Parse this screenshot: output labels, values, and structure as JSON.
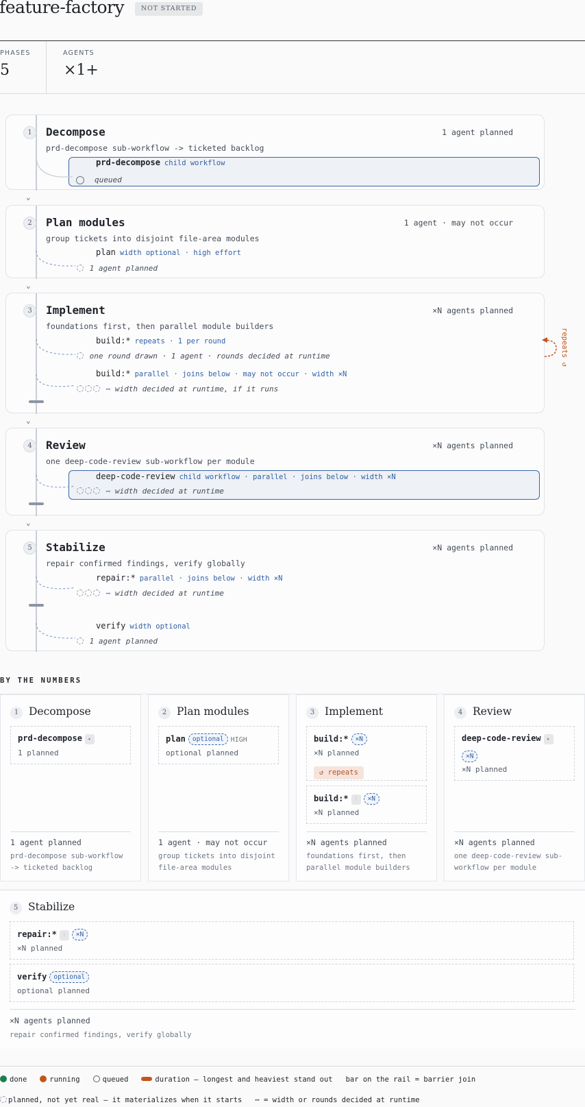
{
  "header": {
    "title": "feature-factory",
    "status": "NOT STARTED"
  },
  "stats": {
    "phases_label": "PHASES",
    "phases_value": "5",
    "agents_label": "AGENTS",
    "agents_value": "×1+"
  },
  "phases": [
    {
      "num": "1",
      "name": "Decompose",
      "meta": "1 agent planned",
      "desc": "prd-decompose sub-workflow -> ticketed backlog",
      "agents": [
        {
          "name": "prd-decompose",
          "tags": "child workflow",
          "note": "queued"
        }
      ]
    },
    {
      "num": "2",
      "name": "Plan modules",
      "meta": "1 agent · may not occur",
      "desc": "group tickets into disjoint file-area modules",
      "agents": [
        {
          "name": "plan",
          "tags": "width optional · high effort",
          "note": "1 agent planned"
        }
      ]
    },
    {
      "num": "3",
      "name": "Implement",
      "meta": "×N agents planned",
      "desc": "foundations first, then parallel module builders",
      "agents": [
        {
          "name": "build:*",
          "tags": "repeats · 1 per round",
          "note": "one round drawn · 1 agent · rounds decided at runtime"
        },
        {
          "name": "build:*",
          "tags": "parallel · joins below · may not occur · width ×N",
          "note": "width decided at runtime, if it runs"
        }
      ],
      "repeats_label": "repeats ↺"
    },
    {
      "num": "4",
      "name": "Review",
      "meta": "×N agents planned",
      "desc": "one deep-code-review sub-workflow per module",
      "agents": [
        {
          "name": "deep-code-review",
          "tags": "child workflow · parallel · joins below · width ×N",
          "note": "width decided at runtime"
        }
      ]
    },
    {
      "num": "5",
      "name": "Stabilize",
      "meta": "×N agents planned",
      "desc": "repair confirmed findings, verify globally",
      "agents": [
        {
          "name": "repair:*",
          "tags": "parallel · joins below · width ×N",
          "note": "width decided at runtime"
        },
        {
          "name": "verify",
          "tags": "width optional",
          "note": "1 agent planned"
        }
      ]
    }
  ],
  "numbers": {
    "heading": "BY THE NUMBERS",
    "cards": [
      {
        "num": "1",
        "name": "Decompose",
        "agents": [
          {
            "name": "prd-decompose",
            "sub": "1 planned"
          }
        ],
        "foot1": "1 agent planned",
        "foot2a": "prd-decompose sub-workflow",
        "foot2b": "-> ticketed backlog"
      },
      {
        "num": "2",
        "name": "Plan modules",
        "agents": [
          {
            "name": "plan",
            "pill": "optional",
            "high": "HIGH",
            "sub": "optional planned"
          }
        ],
        "foot1": "1 agent · may not occur",
        "foot2a": "group tickets into disjoint",
        "foot2b": "file-area modules"
      },
      {
        "num": "3",
        "name": "Implement",
        "agents": [
          {
            "name": "build:*",
            "pill": "×N",
            "sub": "×N planned",
            "badge": "↺ repeats"
          },
          {
            "name": "build:*",
            "pill": "×N",
            "sub": "×N planned"
          }
        ],
        "foot1": "×N agents planned",
        "foot2a": "foundations first, then",
        "foot2b": "parallel module builders"
      },
      {
        "num": "4",
        "name": "Review",
        "agents": [
          {
            "name": "deep-code-review",
            "pill": "×N",
            "sub": "×N planned"
          }
        ],
        "foot1": "×N agents planned",
        "foot2a": "one deep-code-review sub-",
        "foot2b": "workflow per module"
      },
      {
        "num": "5",
        "name": "Stabilize",
        "agents": [
          {
            "name": "repair:*",
            "pill": "×N",
            "sub": "×N planned"
          },
          {
            "name": "verify",
            "pill": "optional",
            "sub": "optional planned"
          }
        ],
        "foot1": "×N agents planned",
        "foot2a": "repair confirmed findings, verify globally"
      }
    ]
  },
  "legend": {
    "done": "done",
    "running": "running",
    "queued": "queued",
    "duration": "duration — longest and heaviest stand out",
    "barrier": "bar on the rail = barrier join",
    "planned": "planned, not yet real — it materializes when it starts",
    "width": "⋯ = width or rounds decided at runtime"
  },
  "colors": {
    "accent_blue": "#2f5fa5",
    "running_orange": "#c4541b",
    "done_green": "#1a7f4b"
  }
}
